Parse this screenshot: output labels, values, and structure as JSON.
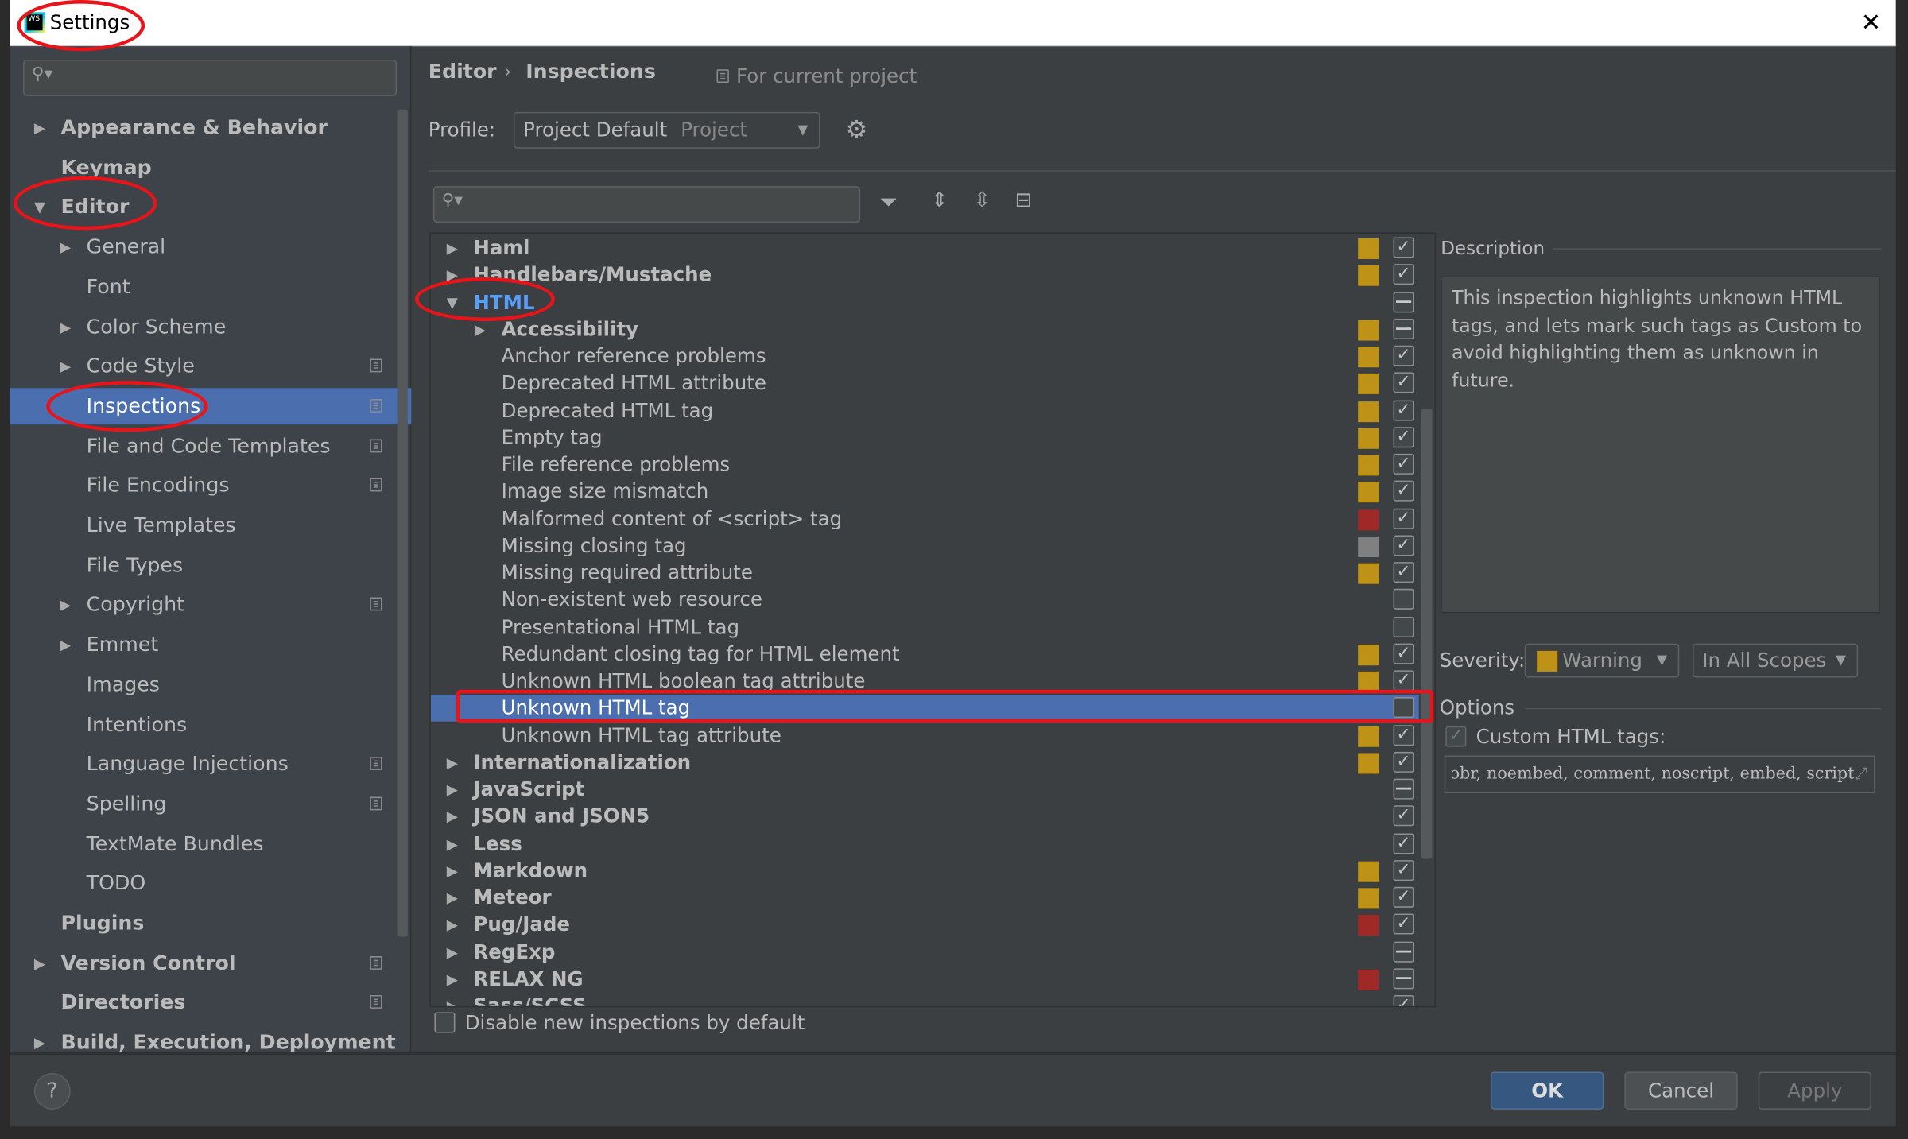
{
  "window": {
    "title": "Settings",
    "close_icon": "close-icon"
  },
  "sidebar": {
    "search_placeholder": "",
    "items": [
      {
        "label": "Appearance & Behavior",
        "level": 0,
        "arrow": "right",
        "copy": false
      },
      {
        "label": "Keymap",
        "level": 0,
        "arrow": "none",
        "copy": false
      },
      {
        "label": "Editor",
        "level": 0,
        "arrow": "down",
        "copy": false
      },
      {
        "label": "General",
        "level": 1,
        "arrow": "right",
        "copy": false
      },
      {
        "label": "Font",
        "level": 1,
        "arrow": "none",
        "copy": false
      },
      {
        "label": "Color Scheme",
        "level": 1,
        "arrow": "right",
        "copy": false
      },
      {
        "label": "Code Style",
        "level": 1,
        "arrow": "right",
        "copy": true
      },
      {
        "label": "Inspections",
        "level": 1,
        "arrow": "none",
        "copy": true,
        "selected": true
      },
      {
        "label": "File and Code Templates",
        "level": 1,
        "arrow": "none",
        "copy": true
      },
      {
        "label": "File Encodings",
        "level": 1,
        "arrow": "none",
        "copy": true
      },
      {
        "label": "Live Templates",
        "level": 1,
        "arrow": "none",
        "copy": false
      },
      {
        "label": "File Types",
        "level": 1,
        "arrow": "none",
        "copy": false
      },
      {
        "label": "Copyright",
        "level": 1,
        "arrow": "right",
        "copy": true
      },
      {
        "label": "Emmet",
        "level": 1,
        "arrow": "right",
        "copy": false
      },
      {
        "label": "Images",
        "level": 1,
        "arrow": "none",
        "copy": false
      },
      {
        "label": "Intentions",
        "level": 1,
        "arrow": "none",
        "copy": false
      },
      {
        "label": "Language Injections",
        "level": 1,
        "arrow": "none",
        "copy": true
      },
      {
        "label": "Spelling",
        "level": 1,
        "arrow": "none",
        "copy": true
      },
      {
        "label": "TextMate Bundles",
        "level": 1,
        "arrow": "none",
        "copy": false
      },
      {
        "label": "TODO",
        "level": 1,
        "arrow": "none",
        "copy": false
      },
      {
        "label": "Plugins",
        "level": 0,
        "arrow": "none",
        "copy": false
      },
      {
        "label": "Version Control",
        "level": 0,
        "arrow": "right",
        "copy": true
      },
      {
        "label": "Directories",
        "level": 0,
        "arrow": "none",
        "copy": true
      },
      {
        "label": "Build, Execution, Deployment",
        "level": 0,
        "arrow": "right",
        "copy": false
      }
    ]
  },
  "header": {
    "breadcrumb": [
      "Editor",
      "Inspections"
    ],
    "breadcrumb_sep": "›",
    "scope_note": "For current project"
  },
  "profile": {
    "label": "Profile:",
    "value": "Project Default",
    "value_hint": "Project"
  },
  "filter": {
    "search_placeholder": ""
  },
  "colors": {
    "warning": "#be9117",
    "error": "#9e2927",
    "weak": "#808080",
    "selection": "#4b6eaf",
    "ok_button": "#365880"
  },
  "tree": [
    {
      "label": "Haml",
      "level": 0,
      "arrow": "right",
      "sev": "warning",
      "check": "checked"
    },
    {
      "label": "Handlebars/Mustache",
      "level": 0,
      "arrow": "right",
      "sev": "warning",
      "check": "checked"
    },
    {
      "label": "HTML",
      "level": 0,
      "arrow": "down",
      "sev": "",
      "check": "partial",
      "highlight": true
    },
    {
      "label": "Accessibility",
      "level": 1,
      "arrow": "right",
      "sev": "warning",
      "check": "partial"
    },
    {
      "label": "Anchor reference problems",
      "level": 2,
      "sev": "warning",
      "check": "checked"
    },
    {
      "label": "Deprecated HTML attribute",
      "level": 2,
      "sev": "warning",
      "check": "checked"
    },
    {
      "label": "Deprecated HTML tag",
      "level": 2,
      "sev": "warning",
      "check": "checked"
    },
    {
      "label": "Empty tag",
      "level": 2,
      "sev": "warning",
      "check": "checked"
    },
    {
      "label": "File reference problems",
      "level": 2,
      "sev": "warning",
      "check": "checked"
    },
    {
      "label": "Image size mismatch",
      "level": 2,
      "sev": "warning",
      "check": "checked"
    },
    {
      "label": "Malformed content of <script> tag",
      "level": 2,
      "sev": "error",
      "check": "checked"
    },
    {
      "label": "Missing closing tag",
      "level": 2,
      "sev": "weak",
      "check": "checked"
    },
    {
      "label": "Missing required attribute",
      "level": 2,
      "sev": "warning",
      "check": "checked"
    },
    {
      "label": "Non-existent web resource",
      "level": 2,
      "sev": "",
      "check": "unchecked"
    },
    {
      "label": "Presentational HTML tag",
      "level": 2,
      "sev": "",
      "check": "unchecked"
    },
    {
      "label": "Redundant closing tag for HTML element",
      "level": 2,
      "sev": "warning",
      "check": "checked"
    },
    {
      "label": "Unknown HTML boolean tag attribute",
      "level": 2,
      "sev": "warning",
      "check": "checked"
    },
    {
      "label": "Unknown HTML tag",
      "level": 2,
      "sev": "",
      "check": "unchecked",
      "selected": true
    },
    {
      "label": "Unknown HTML tag attribute",
      "level": 2,
      "sev": "warning",
      "check": "checked"
    },
    {
      "label": "Internationalization",
      "level": 0,
      "arrow": "right",
      "sev": "warning",
      "check": "checked"
    },
    {
      "label": "JavaScript",
      "level": 0,
      "arrow": "right",
      "sev": "",
      "check": "partial"
    },
    {
      "label": "JSON and JSON5",
      "level": 0,
      "arrow": "right",
      "sev": "",
      "check": "checked"
    },
    {
      "label": "Less",
      "level": 0,
      "arrow": "right",
      "sev": "",
      "check": "checked"
    },
    {
      "label": "Markdown",
      "level": 0,
      "arrow": "right",
      "sev": "warning",
      "check": "checked"
    },
    {
      "label": "Meteor",
      "level": 0,
      "arrow": "right",
      "sev": "warning",
      "check": "checked"
    },
    {
      "label": "Pug/Jade",
      "level": 0,
      "arrow": "right",
      "sev": "error",
      "check": "checked"
    },
    {
      "label": "RegExp",
      "level": 0,
      "arrow": "right",
      "sev": "",
      "check": "partial"
    },
    {
      "label": "RELAX NG",
      "level": 0,
      "arrow": "right",
      "sev": "error",
      "check": "partial"
    },
    {
      "label": "Sass/SCSS",
      "level": 0,
      "arrow": "right",
      "sev": "",
      "check": "checked"
    }
  ],
  "disable_new": {
    "label": "Disable new inspections by default",
    "checked": false
  },
  "description": {
    "title": "Description",
    "text": "This inspection highlights unknown HTML tags, and lets mark such tags as Custom to avoid highlighting them as unknown in future."
  },
  "severity": {
    "label": "Severity:",
    "value": "Warning",
    "scope": "In All Scopes"
  },
  "options": {
    "title": "Options",
    "custom_tags_label": "Custom HTML tags:",
    "custom_tags_checked": true,
    "custom_tags_value": "ɔbr, noembed, comment, noscript, embed, script"
  },
  "footer": {
    "help": "?",
    "ok": "OK",
    "cancel": "Cancel",
    "apply": "Apply"
  }
}
